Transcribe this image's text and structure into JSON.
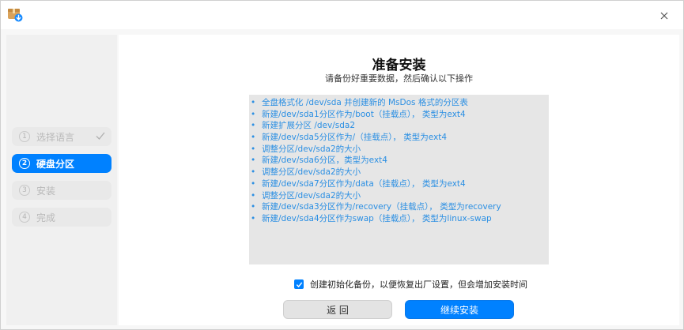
{
  "window": {
    "app_icon": "installer-package-icon",
    "close_icon": "close-icon"
  },
  "sidebar": {
    "steps": [
      {
        "num": "1",
        "label": "选择语言",
        "state": "done"
      },
      {
        "num": "2",
        "label": "硬盘分区",
        "state": "active"
      },
      {
        "num": "3",
        "label": "安装",
        "state": "pending"
      },
      {
        "num": "4",
        "label": "完成",
        "state": "pending"
      }
    ]
  },
  "main": {
    "title": "准备安装",
    "subtitle": "请备份好重要数据，然后确认以下操作",
    "operations": [
      "全盘格式化 /dev/sda 并创建新的 MsDos 格式的分区表",
      "新建/dev/sda1分区作为/boot（挂载点）， 类型为ext4",
      "新建扩展分区 /dev/sda2",
      "新建/dev/sda5分区作为/（挂载点）， 类型为ext4",
      "调整分区/dev/sda2的大小",
      "新建/dev/sda6分区，类型为ext4",
      "调整分区/dev/sda2的大小",
      "新建/dev/sda7分区作为/data（挂载点）， 类型为ext4",
      "调整分区/dev/sda2的大小",
      "新建/dev/sda3分区作为/recovery（挂载点）， 类型为recovery",
      "新建/dev/sda4分区作为swap（挂载点）， 类型为linux-swap"
    ],
    "bullet": "•",
    "backup_checkbox": {
      "checked": true,
      "label": "创建初始化备份，以便恢复出厂设置，但会增加安装时间"
    },
    "back_button": "返 回",
    "continue_button": "继续安装"
  },
  "colors": {
    "accent": "#0081ff",
    "ops_text": "#2b8fe3",
    "ops_bg": "#e6e6e6"
  }
}
